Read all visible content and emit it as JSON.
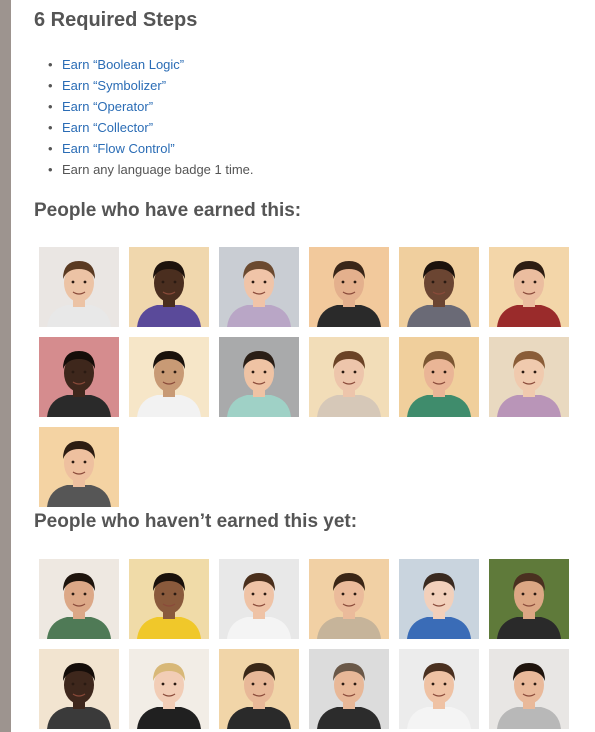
{
  "requirements": {
    "title": "6 Required Steps",
    "steps": [
      {
        "text": "Earn “Boolean Logic”",
        "link": true
      },
      {
        "text": "Earn “Symbolizer”",
        "link": true
      },
      {
        "text": "Earn “Operator”",
        "link": true
      },
      {
        "text": "Earn “Collector”",
        "link": true
      },
      {
        "text": "Earn “Flow Control”",
        "link": true
      },
      {
        "text": "Earn any language badge 1 time.",
        "link": false
      }
    ]
  },
  "earned": {
    "heading": "People who have earned this:",
    "people": [
      {
        "bg": "#eae6e3",
        "skin": "#ecc3a5",
        "hair": "#5a3a22",
        "shirt": "#e8e8e8"
      },
      {
        "bg": "#f0d7ad",
        "skin": "#4a2e1f",
        "hair": "#1e130d",
        "shirt": "#5a4a9a"
      },
      {
        "bg": "#c9cdd3",
        "skin": "#f0c4a8",
        "hair": "#6b4a30",
        "shirt": "#b9a6c6"
      },
      {
        "bg": "#f2c99c",
        "skin": "#e4b08d",
        "hair": "#3a2618",
        "shirt": "#2a2a2a"
      },
      {
        "bg": "#f0cf9e",
        "skin": "#6b4532",
        "hair": "#1c120c",
        "shirt": "#6a6a76"
      },
      {
        "bg": "#f3d6a9",
        "skin": "#ebbd9f",
        "hair": "#2d1d12",
        "shirt": "#9a2b2b"
      },
      {
        "bg": "#d58c8e",
        "skin": "#3e271c",
        "hair": "#150d09",
        "shirt": "#2a2a2a"
      },
      {
        "bg": "#f6e6c8",
        "skin": "#c89a75",
        "hair": "#1a120c",
        "shirt": "#f2f2f2"
      },
      {
        "bg": "#a9aaab",
        "skin": "#efc3a4",
        "hair": "#2a1e16",
        "shirt": "#9fd1c6"
      },
      {
        "bg": "#f2ddb8",
        "skin": "#edc5ab",
        "hair": "#6b4326",
        "shirt": "#d6c8b8"
      },
      {
        "bg": "#f0cf9c",
        "skin": "#eab596",
        "hair": "#7b5632",
        "shirt": "#3f8c6c"
      },
      {
        "bg": "#e9d9c0",
        "skin": "#f0caae",
        "hair": "#8a5d38",
        "shirt": "#b995b8"
      },
      {
        "bg": "#f4d3a3",
        "skin": "#eec09f",
        "hair": "#2d1d12",
        "shirt": "#565656"
      }
    ]
  },
  "not_earned": {
    "heading": "People who haven’t earned this yet:",
    "people": [
      {
        "bg": "#eee8e1",
        "skin": "#dca887",
        "hair": "#1e140d",
        "shirt": "#4f7a56"
      },
      {
        "bg": "#f0dba8",
        "skin": "#8a5a3c",
        "hair": "#1a110b",
        "shirt": "#f0c82a"
      },
      {
        "bg": "#e8e8e8",
        "skin": "#efc3a6",
        "hair": "#4a2f1c",
        "shirt": "#f4f4f4"
      },
      {
        "bg": "#f1d0a4",
        "skin": "#ebbb9b",
        "hair": "#3b2616",
        "shirt": "#c6b49a"
      },
      {
        "bg": "#c9d4de",
        "skin": "#f2d0bb",
        "hair": "#3a2a20",
        "shirt": "#3a6cb7"
      },
      {
        "bg": "#5f7a3a",
        "skin": "#dca784",
        "hair": "#4a3020",
        "shirt": "#2a2a2a"
      },
      {
        "bg": "#f2e4d0",
        "skin": "#3e271c",
        "hair": "#150d09",
        "shirt": "#3a3a3a"
      },
      {
        "bg": "#f2ede6",
        "skin": "#f2cdb6",
        "hair": "#d8b878",
        "shirt": "#202020"
      },
      {
        "bg": "#f1d5a8",
        "skin": "#e8b898",
        "hair": "#3a2818",
        "shirt": "#2a2a2a"
      },
      {
        "bg": "#dcdcdc",
        "skin": "#e8b898",
        "hair": "#6a5848",
        "shirt": "#2c2c2c"
      },
      {
        "bg": "#ececec",
        "skin": "#efc2a4",
        "hair": "#4a3020",
        "shirt": "#f4f4f4"
      },
      {
        "bg": "#e8e6e4",
        "skin": "#e9b99a",
        "hair": "#1f140d",
        "shirt": "#b8b8b8"
      }
    ]
  }
}
